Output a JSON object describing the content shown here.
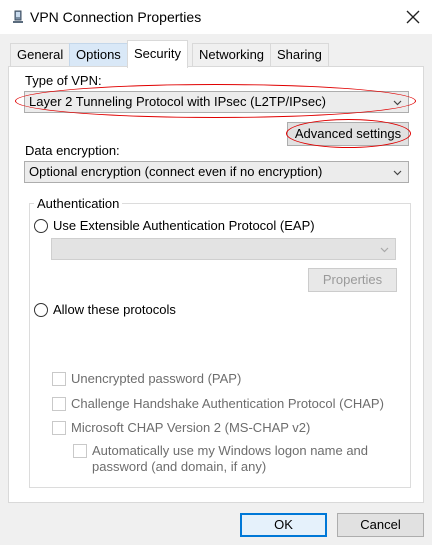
{
  "window": {
    "title": "VPN Connection Properties",
    "icon": "vpn-network-icon"
  },
  "tabs": [
    {
      "label": "General"
    },
    {
      "label": "Options"
    },
    {
      "label": "Security"
    },
    {
      "label": "Networking"
    },
    {
      "label": "Sharing"
    }
  ],
  "security": {
    "vpn_type_label": "Type of VPN:",
    "vpn_type_value": "Layer 2 Tunneling Protocol with IPsec (L2TP/IPsec)",
    "advanced_settings_label": "Advanced settings",
    "data_encryption_label": "Data encryption:",
    "data_encryption_value": "Optional encryption (connect even if no encryption)",
    "authentication": {
      "title": "Authentication",
      "eap_label": "Use Extensible Authentication Protocol (EAP)",
      "eap_value": "",
      "properties_label": "Properties",
      "allow_protocols_label": "Allow these protocols",
      "pap_label": "Unencrypted password (PAP)",
      "chap_label": "Challenge Handshake Authentication Protocol (CHAP)",
      "mschap_label": "Microsoft CHAP Version 2 (MS-CHAP v2)",
      "auto_logon_label_line1": "Automatically use my Windows logon name and",
      "auto_logon_label_line2": "password (and domain, if any)"
    }
  },
  "footer": {
    "ok_label": "OK",
    "cancel_label": "Cancel"
  },
  "annotation_color": "#e00000",
  "accent_color": "#0078d7"
}
